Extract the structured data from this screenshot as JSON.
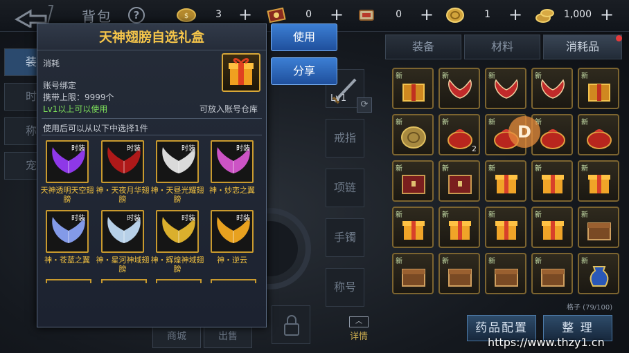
{
  "header": {
    "title": "背包",
    "help_label": "?",
    "currencies": [
      {
        "icon": "coin-icon",
        "value": "3"
      },
      {
        "icon": "ticket-icon",
        "value": "0"
      },
      {
        "icon": "scroll-icon",
        "value": "0"
      },
      {
        "icon": "gold-coin-icon",
        "value": "1"
      },
      {
        "icon": "gold-pile-icon",
        "value": "1,000"
      }
    ],
    "plus_label": "+"
  },
  "sidebar": {
    "items": [
      {
        "label": "装"
      },
      {
        "label": "时"
      },
      {
        "label": "称"
      },
      {
        "label": "宠"
      }
    ]
  },
  "equipment": {
    "level_label": "Lv1",
    "slots": [
      "戒指",
      "项链",
      "手镯",
      "称号"
    ],
    "bottom_buttons": [
      "商城",
      "出售"
    ],
    "details_label": "详情"
  },
  "inventory": {
    "tabs": [
      "装备",
      "材料",
      "消耗品"
    ],
    "active_tab": 2,
    "new_label": "新",
    "grid": [
      [
        {
          "new": true,
          "kind": "gold-chest"
        },
        {
          "new": true,
          "kind": "red-wings"
        },
        {
          "new": true,
          "kind": "red-wings"
        },
        {
          "new": true,
          "kind": "red-wings"
        },
        {
          "new": true,
          "kind": "gold-chest"
        }
      ],
      [
        {
          "new": true,
          "kind": "coin"
        },
        {
          "new": true,
          "kind": "red-bag",
          "count": "2"
        },
        {
          "new": true,
          "kind": "red-bag"
        },
        {
          "new": true,
          "kind": "red-bag"
        },
        {
          "new": true,
          "kind": "red-bag"
        }
      ],
      [
        {
          "new": true,
          "kind": "red-chest"
        },
        {
          "new": true,
          "kind": "red-chest"
        },
        {
          "new": true,
          "kind": "gift-box"
        },
        {
          "new": true,
          "kind": "gift-box"
        },
        {
          "new": true,
          "kind": "gift-box"
        }
      ],
      [
        {
          "new": true,
          "kind": "gift-box"
        },
        {
          "new": true,
          "kind": "gift-box"
        },
        {
          "new": true,
          "kind": "gift-box"
        },
        {
          "new": true,
          "kind": "gift-box"
        },
        {
          "new": true,
          "kind": "wood-chest"
        }
      ],
      [
        {
          "new": true,
          "kind": "wood-chest"
        },
        {
          "new": true,
          "kind": "wood-chest"
        },
        {
          "new": true,
          "kind": "wood-chest"
        },
        {
          "new": true,
          "kind": "wood-chest"
        },
        {
          "new": true,
          "kind": "blue-vase"
        }
      ]
    ],
    "capacity": "格子 (79/100)",
    "potion_button": "药品配置",
    "sort_button": "整 理"
  },
  "popup": {
    "title": "天神翅膀自选礼盒",
    "category": "消耗",
    "binding": "账号绑定",
    "carry_limit": "携带上限：9999个",
    "level_req": "Lv1以上可以使用",
    "warehouse_note": "可放入账号仓库",
    "choose_text": "使用后可以从以下中选择1件",
    "use_button": "使用",
    "share_button": "分享",
    "items": [
      {
        "tag": "时装",
        "name": "天神透明天空翅膀",
        "color": "#9b3cff"
      },
      {
        "tag": "时装",
        "name": "神・天夜月华翅膀",
        "color": "#c01a1a"
      },
      {
        "tag": "时装",
        "name": "神・天昼光耀翅膀",
        "color": "#f0f0f0"
      },
      {
        "tag": "时装",
        "name": "神・妙恋之翼",
        "color": "#e05ad8"
      },
      {
        "tag": "时装",
        "name": "神・苍蓝之翼",
        "color": "#8fa8ff"
      },
      {
        "tag": "时装",
        "name": "神・星河神域翅膀",
        "color": "#c9e4ff"
      },
      {
        "tag": "时装",
        "name": "神・辉煌神域翅膀",
        "color": "#f0c030"
      },
      {
        "tag": "时装",
        "name": "神・逆云",
        "color": "#ffb020"
      }
    ]
  },
  "watermark": "https://www.thzy1.cn"
}
